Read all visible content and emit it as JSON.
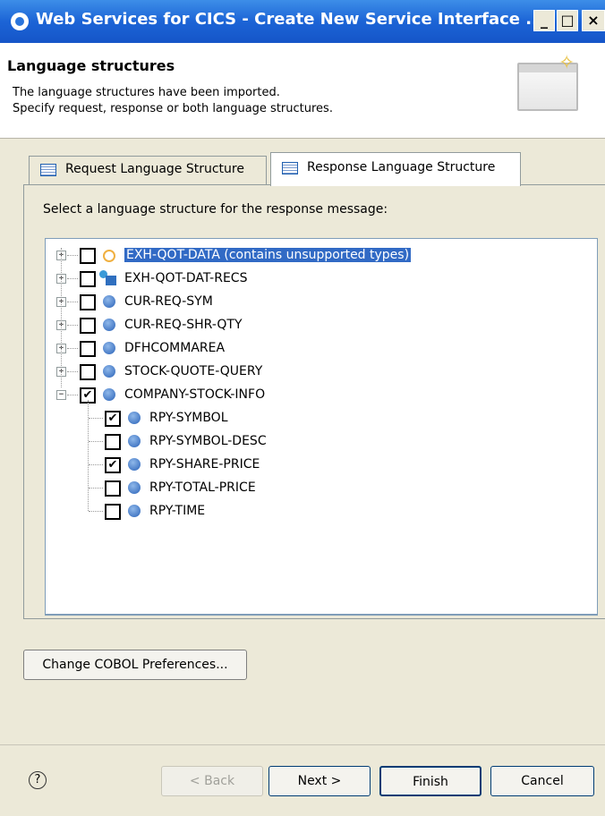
{
  "window": {
    "title": "Web Services for CICS - Create New Service Interface ...",
    "min_label": "_",
    "max_label": "□",
    "close_label": "×"
  },
  "header": {
    "title": "Language structures",
    "desc_line1": "The language structures have been imported.",
    "desc_line2": "Specify request, response or both language structures."
  },
  "tabs": {
    "request": "Request Language Structure",
    "response": "Response Language Structure"
  },
  "prompt": "Select a language structure for the response message:",
  "tree": {
    "items": [
      {
        "label": "EXH-QOT-DATA  (contains unsupported types)",
        "checked": false,
        "selected": true,
        "icon": "empty-circle-icon"
      },
      {
        "label": "EXH-QOT-DAT-RECS",
        "checked": false,
        "icon": "records-icon"
      },
      {
        "label": "CUR-REQ-SYM",
        "checked": false,
        "icon": "field-icon"
      },
      {
        "label": "CUR-REQ-SHR-QTY",
        "checked": false,
        "icon": "field-icon"
      },
      {
        "label": "DFHCOMMAREA",
        "checked": false,
        "icon": "field-icon"
      },
      {
        "label": "STOCK-QUOTE-QUERY",
        "checked": false,
        "icon": "field-icon"
      },
      {
        "label": "COMPANY-STOCK-INFO",
        "checked": true,
        "expanded": true,
        "icon": "field-icon"
      }
    ],
    "children": [
      {
        "label": "RPY-SYMBOL",
        "checked": true
      },
      {
        "label": "RPY-SYMBOL-DESC",
        "checked": false
      },
      {
        "label": "RPY-SHARE-PRICE",
        "checked": true
      },
      {
        "label": "RPY-TOTAL-PRICE",
        "checked": false
      },
      {
        "label": "RPY-TIME",
        "checked": false
      }
    ],
    "check_glyph": "✔",
    "plus_glyph": "+",
    "minus_glyph": "−"
  },
  "buttons": {
    "cobol": "Change COBOL Preferences...",
    "back": "< Back",
    "next": "Next >",
    "finish": "Finish",
    "cancel": "Cancel",
    "help": "?"
  }
}
